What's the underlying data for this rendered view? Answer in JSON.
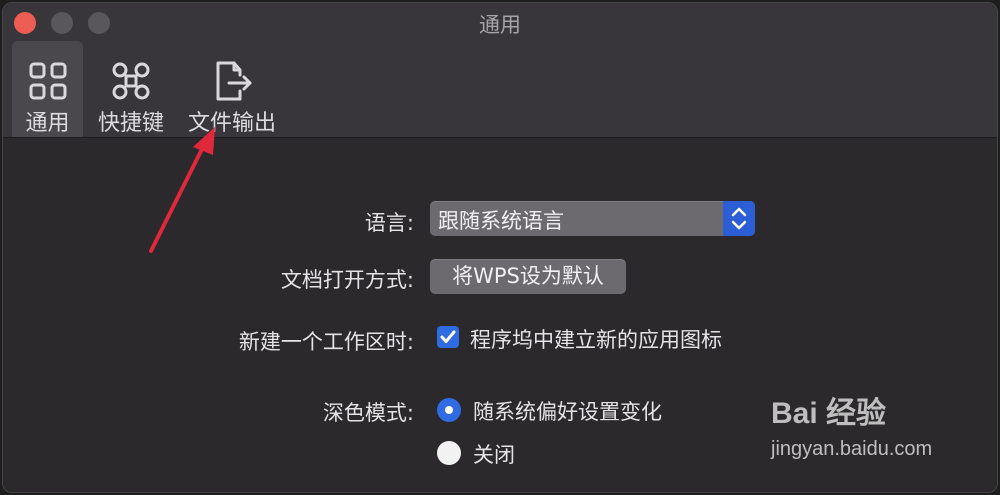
{
  "window": {
    "title": "通用"
  },
  "toolbar": {
    "tabs": [
      {
        "label": "通用",
        "icon": "grid-icon",
        "active": true
      },
      {
        "label": "快捷键",
        "icon": "command-icon",
        "active": false
      },
      {
        "label": "文件输出",
        "icon": "file-export-icon",
        "active": false
      }
    ]
  },
  "form": {
    "language": {
      "label": "语言:",
      "value": "跟随系统语言"
    },
    "open_docs": {
      "label": "文档打开方式:",
      "button": "将WPS设为默认"
    },
    "new_workspace": {
      "label": "新建一个工作区时:",
      "checkbox_label": "程序坞中建立新的应用图标",
      "checked": true
    },
    "dark_mode": {
      "label": "深色模式:",
      "options": [
        {
          "label": "随系统偏好设置变化",
          "selected": true
        },
        {
          "label": "关闭",
          "selected": false
        }
      ]
    }
  },
  "watermark": {
    "brand": "Bai 经验",
    "url": "jingyan.baidu.com"
  },
  "colors": {
    "accent": "#2f6be3",
    "annotation_arrow": "#e0283c"
  }
}
